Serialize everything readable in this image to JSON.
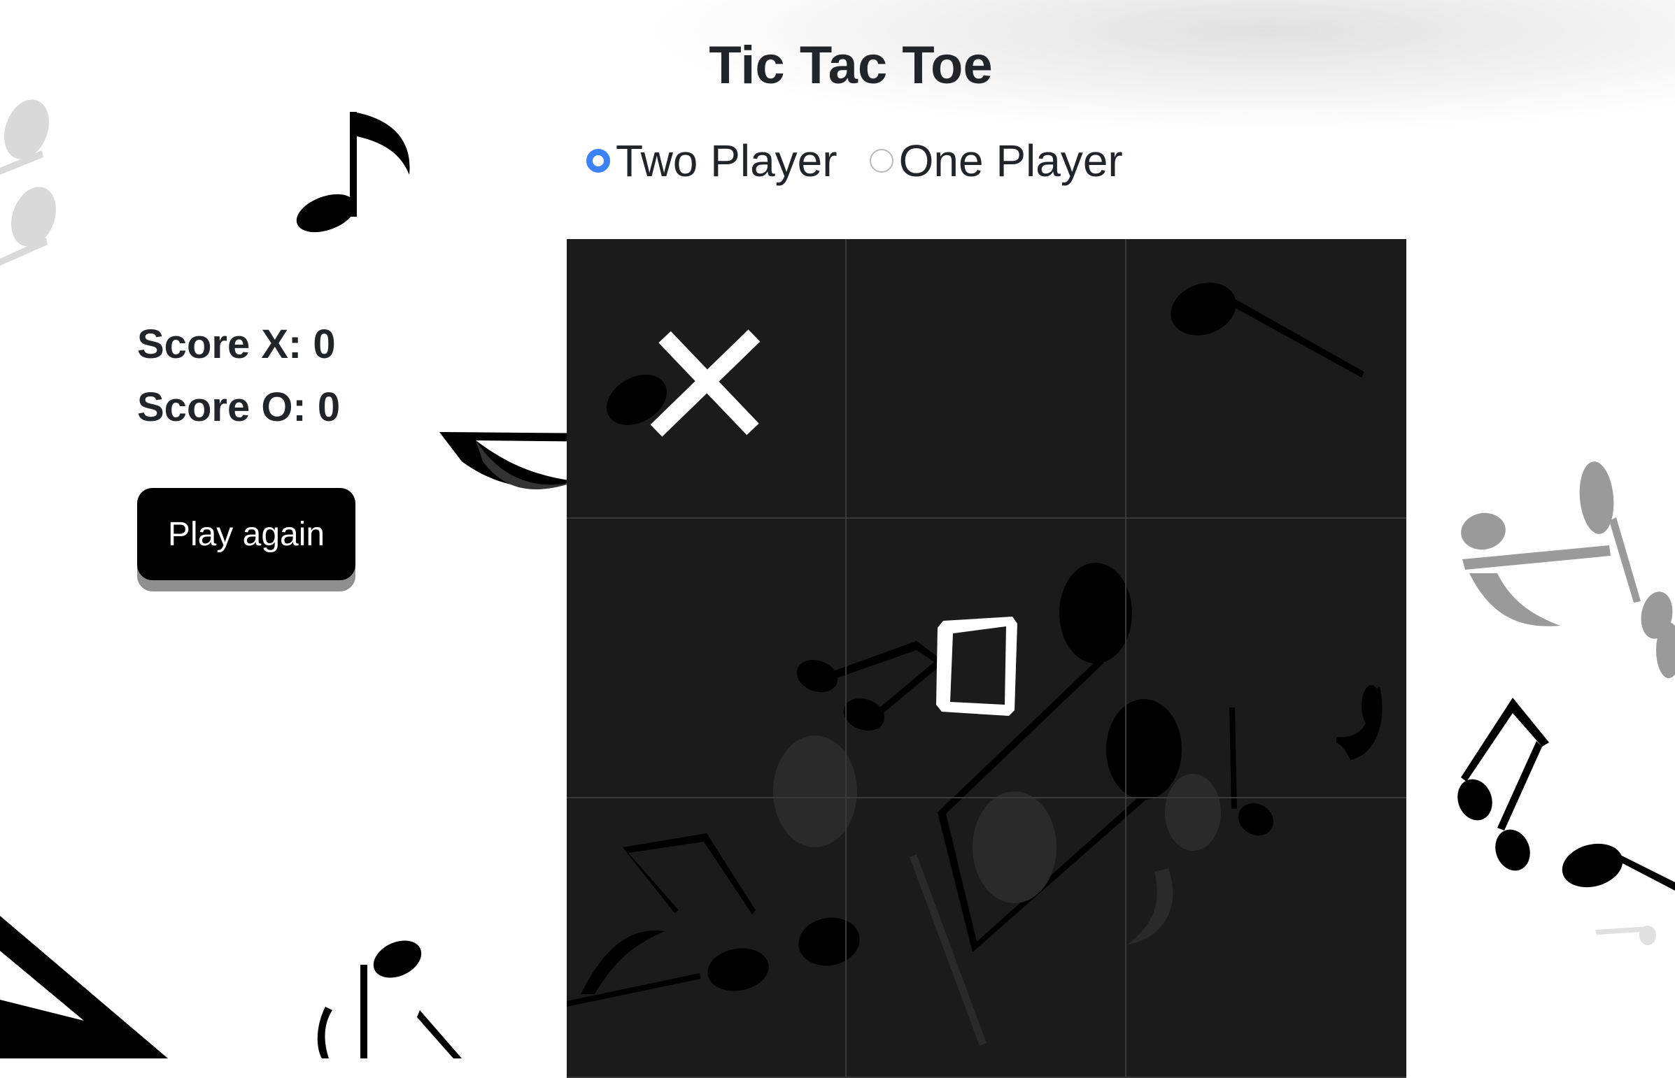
{
  "title": "Tic Tac Toe",
  "modes": [
    {
      "label": "Two Player",
      "selected": true
    },
    {
      "label": "One Player",
      "selected": false
    }
  ],
  "scores": {
    "x_label": "Score X: 0",
    "o_label": "Score O: 0"
  },
  "play_again_label": "Play again",
  "board": [
    "X",
    "",
    "",
    "",
    "O",
    "",
    "",
    "",
    ""
  ],
  "colors": {
    "board_bg": "#1b1b1b",
    "mark": "#ffffff",
    "radio_accent": "#3b82f6",
    "button_bg": "#000000"
  },
  "decorations": [
    "music-note-icon"
  ]
}
